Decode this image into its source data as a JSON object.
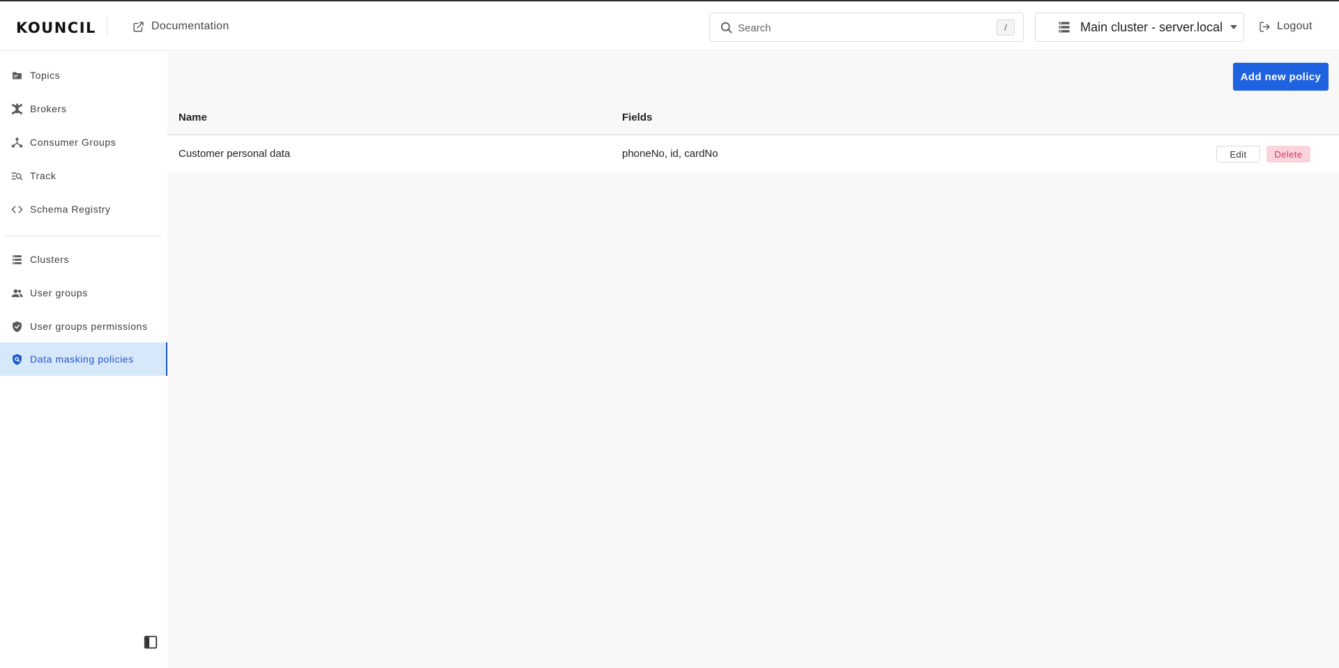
{
  "header": {
    "logo": "KOUNCIL",
    "documentation_label": "Documentation",
    "search_placeholder": "Search",
    "search_shortcut": "/",
    "cluster_selected": "Main cluster - server.local",
    "logout_label": "Logout"
  },
  "sidebar": {
    "items": [
      {
        "label": "Topics",
        "icon": "folder-icon"
      },
      {
        "label": "Brokers",
        "icon": "network-icon"
      },
      {
        "label": "Consumer Groups",
        "icon": "consumer-groups-icon"
      },
      {
        "label": "Track",
        "icon": "track-icon"
      },
      {
        "label": "Schema Registry",
        "icon": "code-icon"
      },
      {
        "label": "Clusters",
        "icon": "server-list-icon"
      },
      {
        "label": "User groups",
        "icon": "user-group-icon"
      },
      {
        "label": "User groups permissions",
        "icon": "shield-check-icon"
      },
      {
        "label": "Data masking policies",
        "icon": "shield-search-icon",
        "active": true
      }
    ]
  },
  "main": {
    "add_button_label": "Add new policy",
    "table": {
      "columns": [
        "Name",
        "Fields"
      ],
      "rows": [
        {
          "name": "Customer personal data",
          "fields": "phoneNo, id, cardNo"
        }
      ],
      "edit_label": "Edit",
      "delete_label": "Delete"
    }
  },
  "colors": {
    "accent": "#1f62e0",
    "active_bg": "#d8e8fb",
    "delete_bg": "#fad3dc",
    "delete_text": "#d43a5c"
  }
}
